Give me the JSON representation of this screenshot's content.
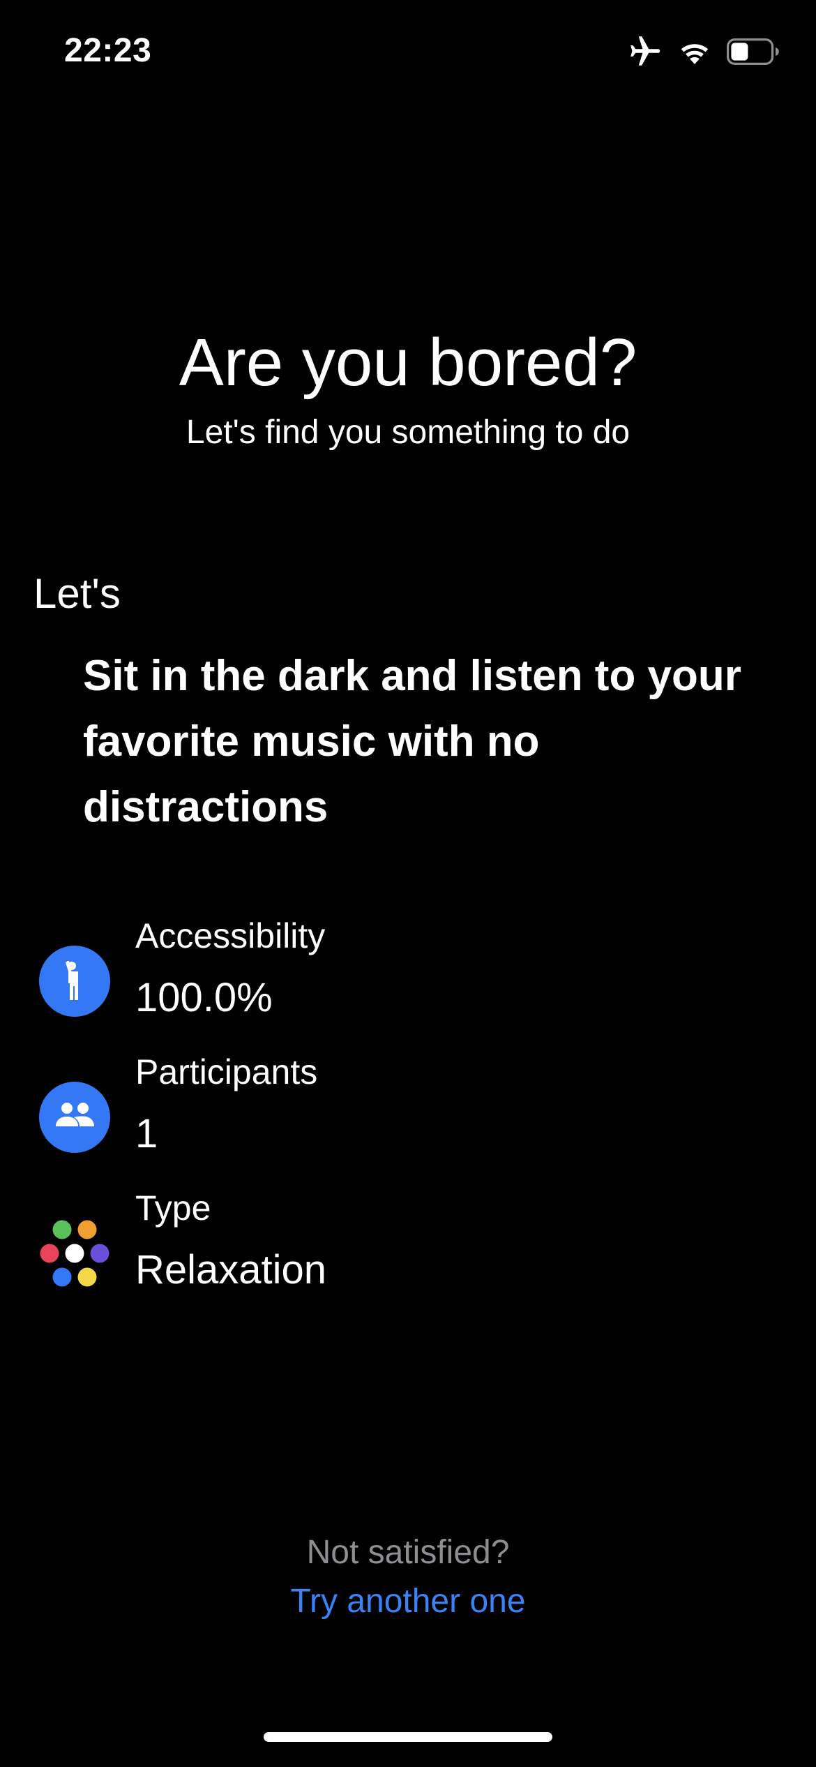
{
  "status_bar": {
    "time": "22:23",
    "icons": [
      "airplane-icon",
      "wifi-icon",
      "battery-icon"
    ]
  },
  "hero": {
    "title": "Are you bored?",
    "subtitle": "Let's find you something to do"
  },
  "activity": {
    "prefix": "Let's",
    "text": "Sit in the dark and listen to your favorite music with no distractions"
  },
  "details": {
    "accessibility": {
      "label": "Accessibility",
      "value": "100.0%",
      "icon": "accessibility-icon"
    },
    "participants": {
      "label": "Participants",
      "value": "1",
      "icon": "participants-icon"
    },
    "type": {
      "label": "Type",
      "value": "Relaxation",
      "icon": "type-dots-icon"
    }
  },
  "footer": {
    "question": "Not satisfied?",
    "link": "Try another one"
  },
  "colors": {
    "background": "#000000",
    "accent_blue": "#3b82f6",
    "icon_blue": "#3478f6",
    "muted_text": "#8d8d92",
    "dot_green": "#5ac05a",
    "dot_orange": "#f0a030",
    "dot_red": "#e8455a",
    "dot_white": "#ffffff",
    "dot_purple": "#6a4fd8",
    "dot_blue": "#3478f6",
    "dot_yellow": "#f5d84a"
  }
}
